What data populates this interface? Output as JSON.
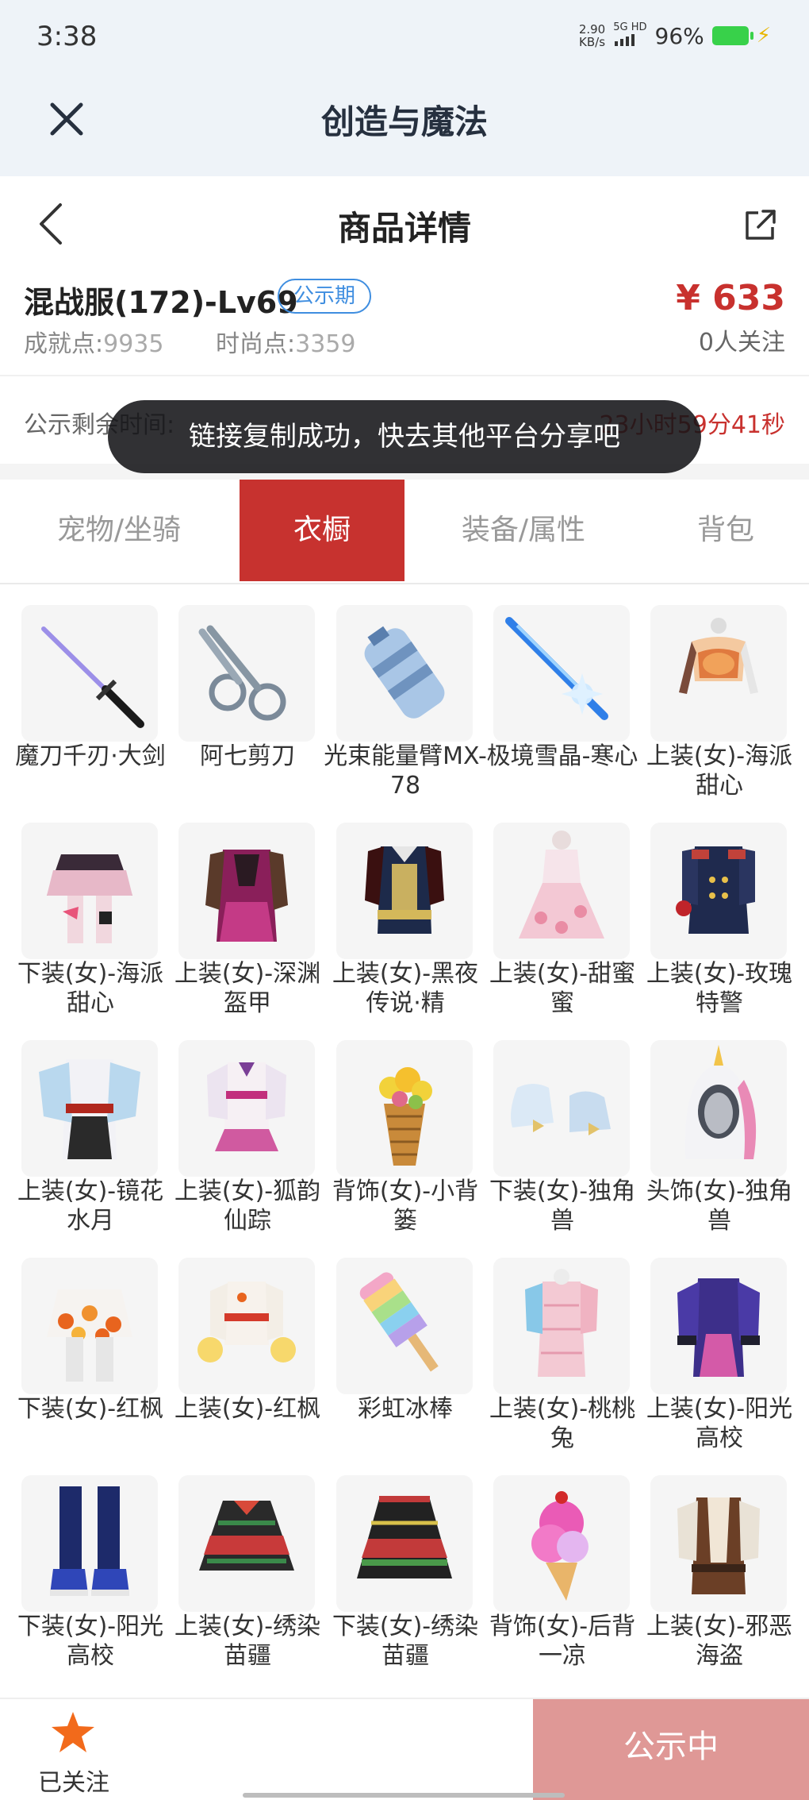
{
  "status": {
    "time": "3:38",
    "speed": "2.90",
    "speed_unit": "KB/s",
    "network": "5G HD",
    "battery": "96%"
  },
  "app": {
    "title": "创造与魔法"
  },
  "detail": {
    "title": "商品详情"
  },
  "product": {
    "name": "混战服(172)-Lv69",
    "badge": "公示期",
    "price": "¥ 633",
    "followers": "0人关注",
    "achievement_label": "成就点:",
    "achievement_value": "9935",
    "fashion_label": "时尚点:",
    "fashion_value": "3359"
  },
  "countdown": {
    "label": "公示剩余时间:",
    "value": "23小时59分41秒"
  },
  "toast": "链接复制成功，快去其他平台分享吧",
  "tabs": [
    {
      "label": "宠物/坐骑",
      "active": false
    },
    {
      "label": "衣橱",
      "active": true
    },
    {
      "label": "装备/属性",
      "active": false
    },
    {
      "label": "背包",
      "active": false
    }
  ],
  "items": [
    {
      "label": "魔刀千刃·大剑",
      "icon": "sword-icon"
    },
    {
      "label": "阿七剪刀",
      "icon": "scissors-icon"
    },
    {
      "label": "光束能量臂MX-78",
      "icon": "energy-arm-icon"
    },
    {
      "label": "极境雪晶-寒心",
      "icon": "ice-sword-icon"
    },
    {
      "label": "上装(女)-海派甜心",
      "icon": "top-outfit-icon"
    },
    {
      "label": "下装(女)-海派甜心",
      "icon": "skirt-icon"
    },
    {
      "label": "上装(女)-深渊盔甲",
      "icon": "armor-outfit-icon"
    },
    {
      "label": "上装(女)-黑夜传说·精",
      "icon": "dark-outfit-icon"
    },
    {
      "label": "上装(女)-甜蜜蜜",
      "icon": "dress-icon"
    },
    {
      "label": "上装(女)-玫瑰特警",
      "icon": "uniform-icon"
    },
    {
      "label": "上装(女)-镜花水月",
      "icon": "kimono-icon"
    },
    {
      "label": "上装(女)-狐韵仙踪",
      "icon": "fox-outfit-icon"
    },
    {
      "label": "背饰(女)-小背篓",
      "icon": "flower-basket-icon"
    },
    {
      "label": "下装(女)-独角兽",
      "icon": "shoes-icon"
    },
    {
      "label": "头饰(女)-独角兽",
      "icon": "unicorn-hood-icon"
    },
    {
      "label": "下装(女)-红枫",
      "icon": "maple-skirt-icon"
    },
    {
      "label": "上装(女)-红枫",
      "icon": "maple-top-icon"
    },
    {
      "label": "彩虹冰棒",
      "icon": "popsicle-icon"
    },
    {
      "label": "上装(女)-桃桃兔",
      "icon": "bunny-outfit-icon"
    },
    {
      "label": "上装(女)-阳光高校",
      "icon": "school-top-icon"
    },
    {
      "label": "下装(女)-阳光高校",
      "icon": "boots-icon"
    },
    {
      "label": "上装(女)-绣染苗疆",
      "icon": "embroidered-top-icon"
    },
    {
      "label": "下装(女)-绣染苗疆",
      "icon": "embroidered-skirt-icon"
    },
    {
      "label": "背饰(女)-后背一凉",
      "icon": "ice-cream-icon"
    },
    {
      "label": "上装(女)-邪恶海盗",
      "icon": "pirate-outfit-icon"
    }
  ],
  "bottom": {
    "follow_label": "已关注",
    "cta_label": "公示中"
  },
  "colors": {
    "accent": "#c7322f",
    "badge_blue": "#3f8ee0",
    "cta_disabled": "#df9896"
  }
}
